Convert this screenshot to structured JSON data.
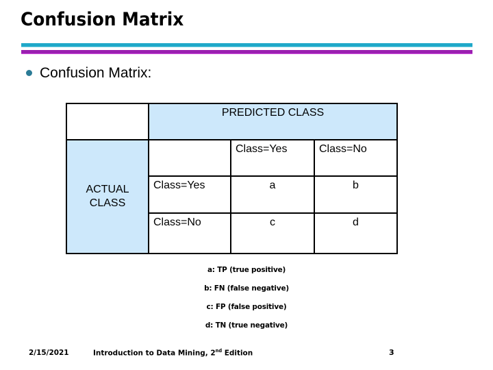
{
  "slide": {
    "title": "Confusion Matrix",
    "bullet_text": "Confusion Matrix:",
    "accent_colors": {
      "bar_top": "#1fa8c9",
      "bar_bottom": "#9a1fb0",
      "bullet": "#2b7b96",
      "table_shade": "#cde8fb"
    }
  },
  "matrix": {
    "corner_blank": "",
    "predicted_header": "PREDICTED CLASS",
    "actual_header": "ACTUAL CLASS",
    "sub_blank": "",
    "predicted_labels": [
      "Class=Yes",
      "Class=No"
    ],
    "actual_labels": [
      "Class=Yes",
      "Class=No"
    ],
    "cells": {
      "yes_yes": "a",
      "yes_no": "b",
      "no_yes": "c",
      "no_no": "d"
    }
  },
  "notes": [
    "a: TP (true positive)",
    "b: FN (false negative)",
    "c: FP (false positive)",
    "d: TN (true negative)"
  ],
  "footer": {
    "date": "2/15/2021",
    "title_prefix": "Introduction to Data Mining, 2",
    "title_sup": "nd",
    "title_suffix": " Edition",
    "page_number": "3"
  }
}
